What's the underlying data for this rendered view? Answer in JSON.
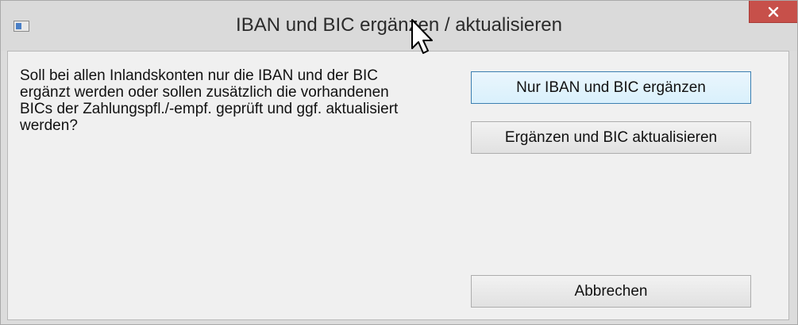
{
  "window": {
    "title": "IBAN und BIC ergänzen / aktualisieren",
    "close_label": "×"
  },
  "dialog": {
    "message": "Soll bei allen Inlandskonten nur die IBAN und der BIC\nergänzt werden oder sollen zusätzlich die vorhandenen\nBICs der Zahlungspfl./-empf. geprüft und ggf. aktualisiert\nwerden?"
  },
  "buttons": {
    "only_add_label": "Nur IBAN und BIC ergänzen",
    "add_update_label": "Ergänzen und BIC aktualisieren",
    "cancel_label": "Abbrechen"
  },
  "icons": {
    "app": "app-window-icon",
    "close": "close-icon",
    "cursor": "mouse-pointer-icon"
  },
  "colors": {
    "close_button": "#c7504a",
    "default_button_border": "#3c7fb1",
    "titlebar": "#dadada",
    "client": "#f0f0f0"
  }
}
